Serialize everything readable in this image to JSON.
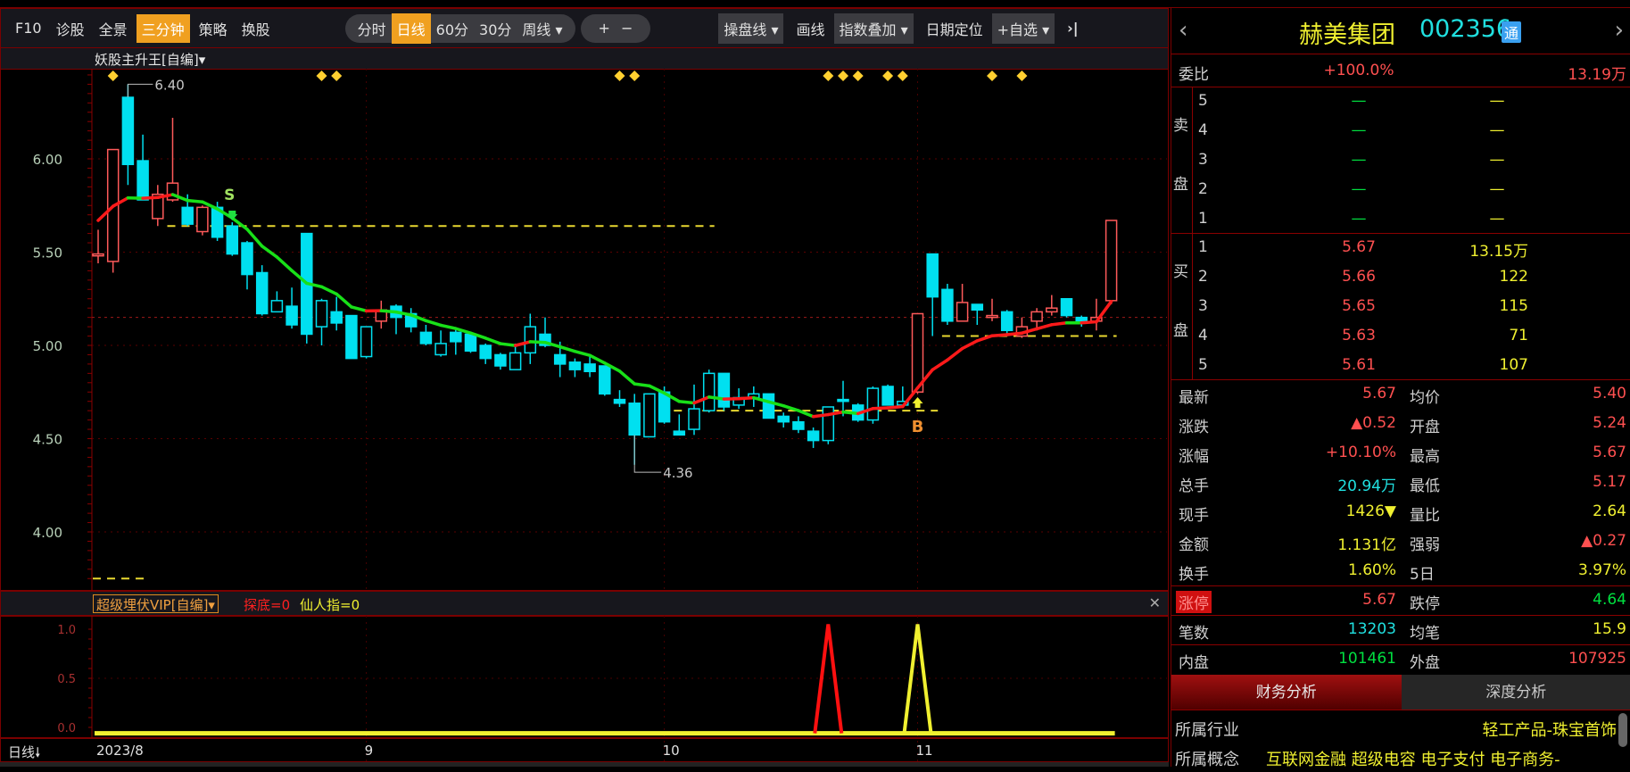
{
  "toolbar": {
    "left": [
      "F10",
      "诊股",
      "全景",
      "三分钟",
      "策略",
      "换股"
    ],
    "active_left": "三分钟",
    "periods": [
      "分时",
      "日线",
      "60分",
      "30分",
      "周线 ▾"
    ],
    "active_period": "日线",
    "zoom_in": "+",
    "zoom_out": "−",
    "caopan": "操盘线 ▾",
    "draw": "画线",
    "index_overlay": "指数叠加 ▾",
    "date_locate": "日期定位",
    "add_fav": "+自选 ▾",
    "collapse": "›|"
  },
  "main_indicator": "妖股主升王[自编]▾",
  "sub_indicator": {
    "name": "超级埋伏VIP[自编]▾",
    "v1": "探底=0",
    "v2": "仙人指=0",
    "close": "✕"
  },
  "period_label": "日线🠗",
  "colors": {
    "up": "#ff5a5a",
    "down": "#00e0f0",
    "ma_up": "#ff1a1a",
    "ma_down": "#18e018",
    "dash": "#e8d830",
    "diamond": "#ffd030",
    "border": "#7a0000"
  },
  "chart_data": {
    "type": "candlestick",
    "y_ticks": [
      "6.00",
      "5.50",
      "5.00",
      "4.50",
      "4.00"
    ],
    "y_tick_values": [
      6.0,
      5.5,
      5.0,
      4.5,
      4.0
    ],
    "ylim": [
      3.7,
      6.45
    ],
    "prev_close": 5.15,
    "x_labels": [
      {
        "i": 0,
        "t": "2023/8"
      },
      {
        "i": 18,
        "t": "9"
      },
      {
        "i": 38,
        "t": "10"
      },
      {
        "i": 55,
        "t": "11"
      }
    ],
    "high_label": {
      "i": 2,
      "text": "6.40"
    },
    "low_label": {
      "i": 36,
      "text": "4.36"
    },
    "candles_ohlc_h": [
      [
        5.48,
        5.62,
        5.44,
        5.49,
        0
      ],
      [
        5.45,
        6.05,
        5.39,
        6.05,
        0
      ],
      [
        6.33,
        6.4,
        5.86,
        5.97,
        0
      ],
      [
        5.99,
        6.13,
        5.78,
        5.78,
        0
      ],
      [
        5.68,
        5.86,
        5.64,
        5.81,
        0
      ],
      [
        5.78,
        6.22,
        5.77,
        5.87,
        0
      ],
      [
        5.74,
        5.81,
        5.64,
        5.65,
        0
      ],
      [
        5.61,
        5.75,
        5.59,
        5.74,
        0
      ],
      [
        5.74,
        5.77,
        5.56,
        5.58,
        0
      ],
      [
        5.64,
        5.66,
        5.48,
        5.49,
        0
      ],
      [
        5.55,
        5.56,
        5.3,
        5.38,
        0
      ],
      [
        5.39,
        5.43,
        5.16,
        5.17,
        0
      ],
      [
        5.18,
        5.29,
        5.18,
        5.24,
        1
      ],
      [
        5.21,
        5.31,
        5.09,
        5.11,
        0
      ],
      [
        5.6,
        5.6,
        5.01,
        5.06,
        0
      ],
      [
        5.1,
        5.25,
        5.0,
        5.24,
        1
      ],
      [
        5.18,
        5.26,
        5.08,
        5.12,
        0
      ],
      [
        5.16,
        5.16,
        4.93,
        4.93,
        0
      ],
      [
        4.94,
        5.1,
        4.93,
        5.1,
        1
      ],
      [
        5.13,
        5.24,
        5.09,
        5.19,
        0
      ],
      [
        5.21,
        5.22,
        5.06,
        5.15,
        0
      ],
      [
        5.17,
        5.2,
        5.07,
        5.1,
        0
      ],
      [
        5.07,
        5.11,
        5.0,
        5.01,
        0
      ],
      [
        4.95,
        5.08,
        4.94,
        5.01,
        1
      ],
      [
        5.07,
        5.09,
        4.95,
        5.02,
        0
      ],
      [
        5.06,
        5.07,
        4.96,
        4.97,
        0
      ],
      [
        5.0,
        5.01,
        4.9,
        4.93,
        0
      ],
      [
        4.95,
        4.96,
        4.87,
        4.89,
        0
      ],
      [
        4.87,
        5.01,
        4.87,
        4.96,
        1
      ],
      [
        4.96,
        5.17,
        4.9,
        5.1,
        1
      ],
      [
        5.06,
        5.15,
        4.99,
        5.0,
        0
      ],
      [
        4.95,
        5.02,
        4.83,
        4.9,
        0
      ],
      [
        4.91,
        4.93,
        4.83,
        4.87,
        0
      ],
      [
        4.9,
        4.94,
        4.83,
        4.86,
        0
      ],
      [
        4.89,
        4.89,
        4.73,
        4.74,
        0
      ],
      [
        4.71,
        4.76,
        4.67,
        4.69,
        0
      ],
      [
        4.69,
        4.74,
        4.36,
        4.52,
        0
      ],
      [
        4.51,
        4.74,
        4.51,
        4.74,
        1
      ],
      [
        4.75,
        4.78,
        4.58,
        4.59,
        0
      ],
      [
        4.54,
        4.63,
        4.52,
        4.52,
        0
      ],
      [
        4.55,
        4.79,
        4.52,
        4.66,
        1
      ],
      [
        4.65,
        4.87,
        4.64,
        4.85,
        1
      ],
      [
        4.85,
        4.85,
        4.65,
        4.67,
        0
      ],
      [
        4.68,
        4.77,
        4.66,
        4.72,
        1
      ],
      [
        4.72,
        4.78,
        4.67,
        4.74,
        1
      ],
      [
        4.74,
        4.74,
        4.61,
        4.61,
        0
      ],
      [
        4.62,
        4.64,
        4.56,
        4.59,
        0
      ],
      [
        4.59,
        4.62,
        4.53,
        4.55,
        0
      ],
      [
        4.54,
        4.56,
        4.45,
        4.49,
        0
      ],
      [
        4.49,
        4.67,
        4.47,
        4.67,
        1
      ],
      [
        4.71,
        4.81,
        4.62,
        4.7,
        0
      ],
      [
        4.68,
        4.69,
        4.59,
        4.6,
        0
      ],
      [
        4.6,
        4.78,
        4.58,
        4.77,
        1
      ],
      [
        4.78,
        4.79,
        4.68,
        4.68,
        0
      ],
      [
        4.68,
        4.78,
        4.68,
        4.7,
        1
      ],
      [
        4.75,
        5.17,
        4.74,
        5.17,
        0
      ],
      [
        5.49,
        5.49,
        5.05,
        5.26,
        0
      ],
      [
        5.3,
        5.33,
        5.11,
        5.13,
        0
      ],
      [
        5.13,
        5.33,
        5.13,
        5.23,
        0
      ],
      [
        5.22,
        5.22,
        5.11,
        5.19,
        0
      ],
      [
        5.15,
        5.25,
        5.13,
        5.16,
        0
      ],
      [
        5.18,
        5.19,
        5.06,
        5.08,
        0
      ],
      [
        5.05,
        5.15,
        5.04,
        5.1,
        0
      ],
      [
        5.13,
        5.2,
        5.08,
        5.18,
        0
      ],
      [
        5.18,
        5.27,
        5.16,
        5.2,
        0
      ],
      [
        5.25,
        5.25,
        5.15,
        5.16,
        0
      ],
      [
        5.15,
        5.16,
        5.1,
        5.12,
        0
      ],
      [
        5.13,
        5.25,
        5.08,
        5.15,
        0
      ],
      [
        5.24,
        5.67,
        5.22,
        5.67,
        0
      ]
    ],
    "dashed_levels": [
      {
        "price": 5.64,
        "from": 5,
        "to": 41
      },
      {
        "price": 4.65,
        "from": 39,
        "to": 56
      },
      {
        "price": 5.05,
        "from": 57,
        "to": 68
      },
      {
        "price": 3.75,
        "from": 0,
        "to": 3
      }
    ],
    "diamond_signals": [
      1,
      15,
      16,
      35,
      36,
      49,
      50,
      51,
      53,
      54,
      60,
      62
    ],
    "sell_signal": {
      "i": 9,
      "text": "S"
    },
    "buy_signal": {
      "i": 55,
      "text": "B"
    },
    "sub": {
      "y_ticks": [
        "1.0",
        "0.5",
        "0.0"
      ],
      "y_tick_values": [
        1,
        0.5,
        0
      ],
      "tandi_spike_i": 49,
      "xianren_spike_i": 55
    }
  },
  "quote": {
    "name": "赫美集团",
    "code": "002356",
    "tag": "通",
    "prev": "‹",
    "next": "›",
    "weibi_label": "委比",
    "weibi": "+100.0%",
    "weicha": "13.19万",
    "sell_side": [
      "卖",
      "盘"
    ],
    "buy_side": [
      "买",
      "盘"
    ],
    "sell": [
      {
        "lv": "5",
        "p": "—",
        "v": "—"
      },
      {
        "lv": "4",
        "p": "—",
        "v": "—"
      },
      {
        "lv": "3",
        "p": "—",
        "v": "—"
      },
      {
        "lv": "2",
        "p": "—",
        "v": "—"
      },
      {
        "lv": "1",
        "p": "—",
        "v": "—"
      }
    ],
    "buy": [
      {
        "lv": "1",
        "p": "5.67",
        "v": "13.15万"
      },
      {
        "lv": "2",
        "p": "5.66",
        "v": "122"
      },
      {
        "lv": "3",
        "p": "5.65",
        "v": "115"
      },
      {
        "lv": "4",
        "p": "5.63",
        "v": "71"
      },
      {
        "lv": "5",
        "p": "5.61",
        "v": "107"
      }
    ],
    "stats": [
      {
        "l1": "最新",
        "v1": "5.67",
        "c1": "red",
        "l2": "均价",
        "v2": "5.40",
        "c2": "red"
      },
      {
        "l1": "涨跌",
        "v1": "▲0.52",
        "c1": "red",
        "l2": "开盘",
        "v2": "5.24",
        "c2": "red"
      },
      {
        "l1": "涨幅",
        "v1": "+10.10%",
        "c1": "red",
        "l2": "最高",
        "v2": "5.67",
        "c2": "red"
      },
      {
        "l1": "总手",
        "v1": "20.94万",
        "c1": "cyan",
        "l2": "最低",
        "v2": "5.17",
        "c2": "red"
      },
      {
        "l1": "现手",
        "v1": "1426▼",
        "c1": "yel",
        "l2": "量比",
        "v2": "2.64",
        "c2": "yel"
      },
      {
        "l1": "金额",
        "v1": "1.131亿",
        "c1": "yel",
        "l2": "强弱",
        "v2": "▲0.27",
        "c2": "red"
      },
      {
        "l1": "换手",
        "v1": "1.60%",
        "c1": "yel",
        "l2": "5日",
        "v2": "3.97%",
        "c2": "yel"
      }
    ],
    "limit": {
      "l1": "涨停",
      "v1": "5.67",
      "l2": "跌停",
      "v2": "4.64"
    },
    "trades": {
      "l1": "笔数",
      "v1": "13203",
      "l2": "均笔",
      "v2": "15.9"
    },
    "inout": {
      "l1": "内盘",
      "v1": "101461",
      "l2": "外盘",
      "v2": "107925"
    },
    "tabs": [
      "财务分析",
      "深度分析"
    ],
    "industry_label": "所属行业",
    "industry": "轻工产品-珠宝首饰",
    "concept_label": "所属概念",
    "concept": "互联网金融 超级电容 电子支付 电子商务-"
  }
}
